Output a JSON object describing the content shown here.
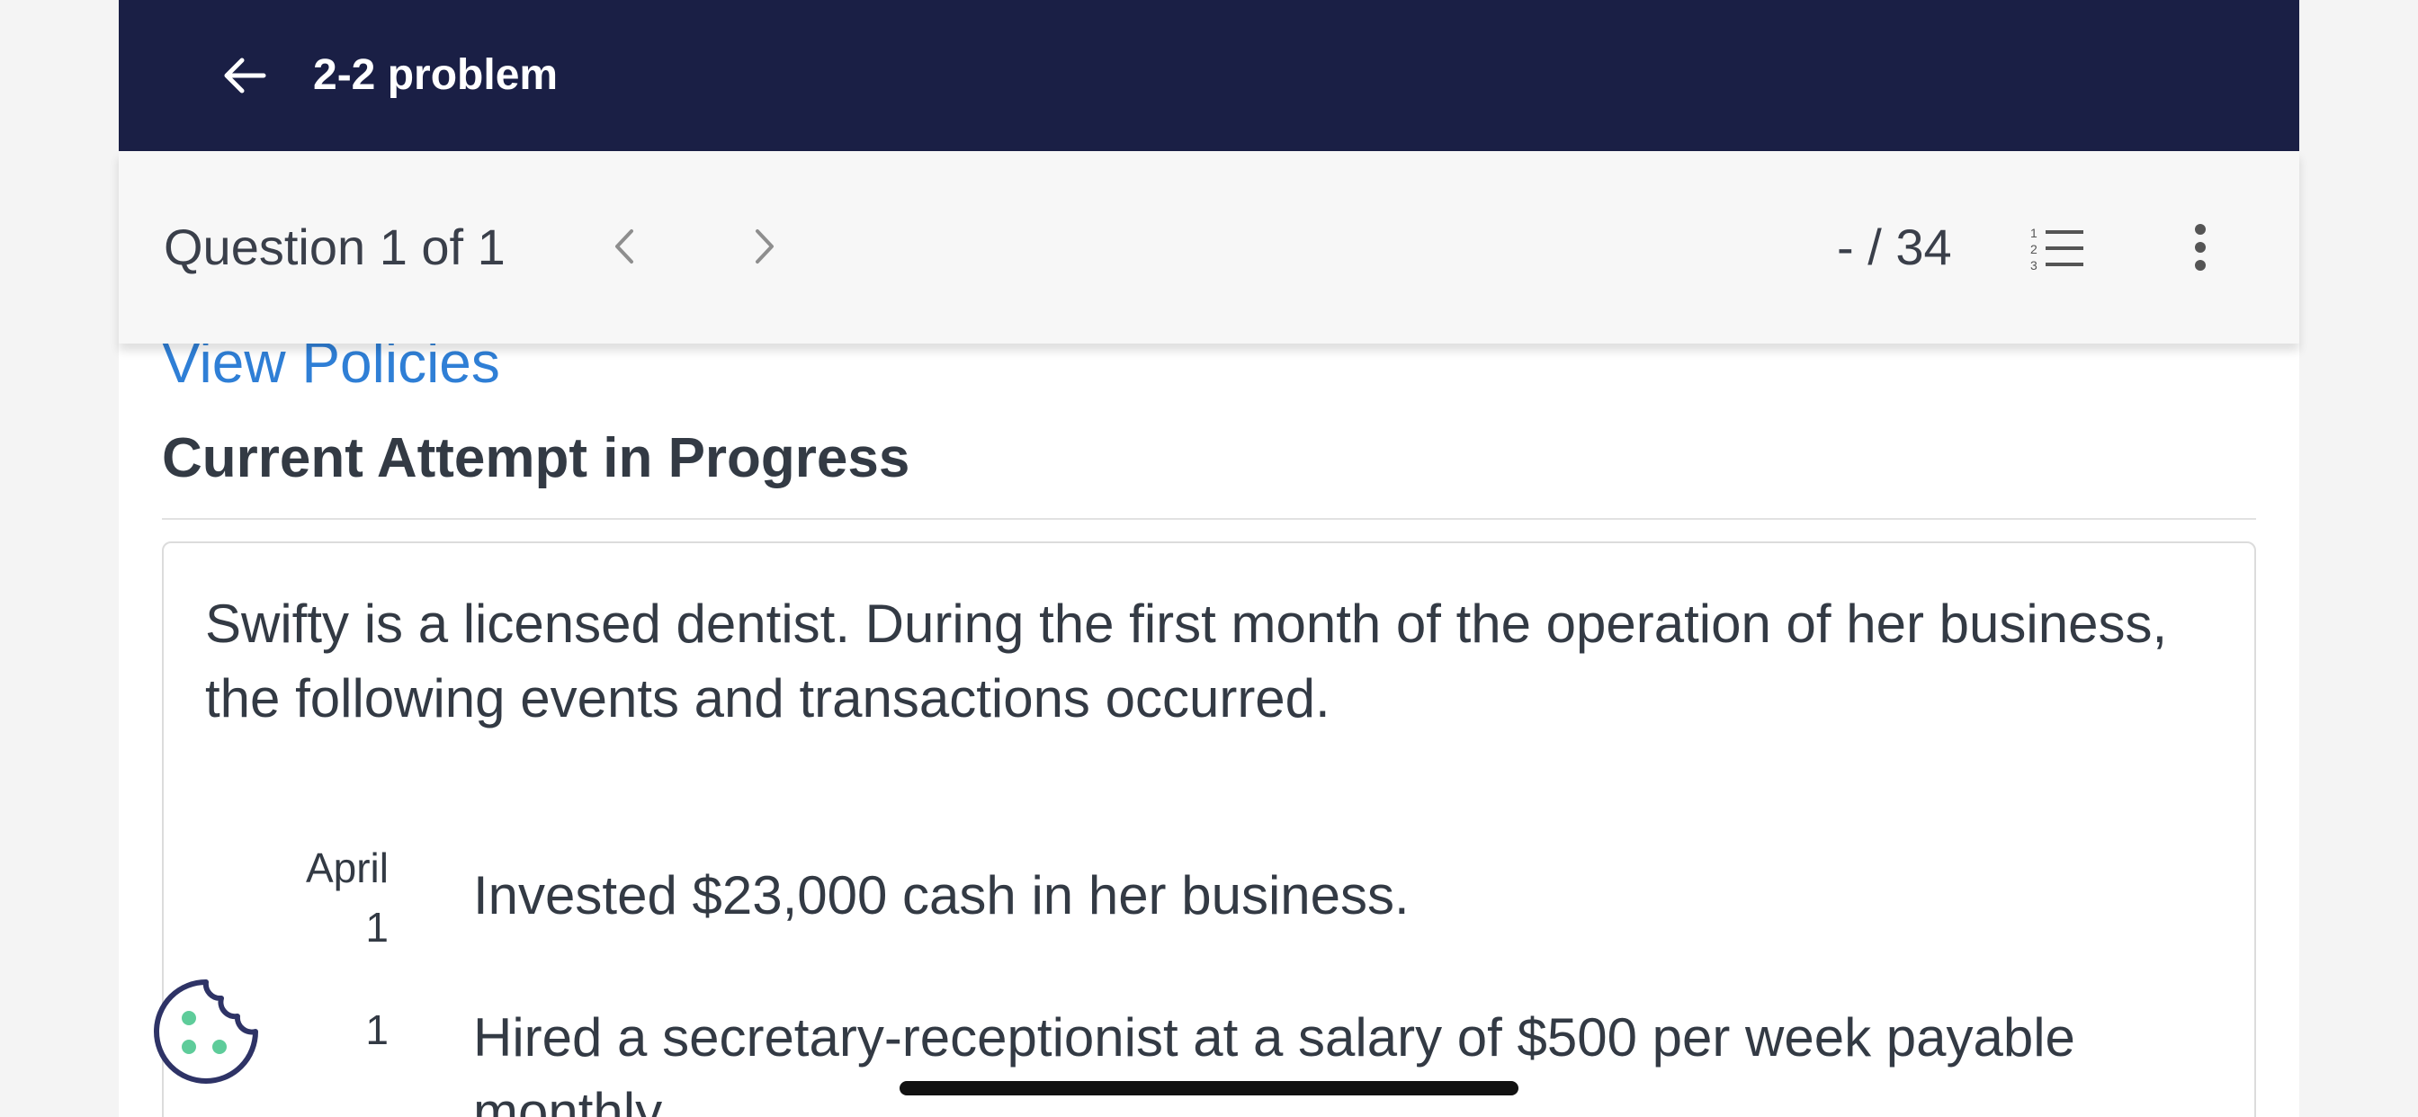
{
  "header": {
    "back_icon": "arrow-left-icon",
    "title": "2-2 problem",
    "bg_color": "#1a1f45"
  },
  "question_bar": {
    "label": "Question 1 of 1",
    "prev_icon": "chevron-left-icon",
    "next_icon": "chevron-right-icon",
    "score": "- / 34",
    "list_icon": "numbered-list-icon",
    "more_icon": "more-vertical-icon"
  },
  "main": {
    "policies_link": "View Policies",
    "attempt_heading": "Current Attempt in Progress",
    "problem": {
      "intro": "Swifty is a licensed dentist. During the first month of the operation of her business, the following events and transactions occurred.",
      "transactions": [
        {
          "month": "April",
          "day": "1",
          "text": "Invested $23,000 cash in her business."
        },
        {
          "month": "",
          "day": "1",
          "text": "Hired a secretary-receptionist at a salary of $500 per week payable monthly."
        }
      ]
    }
  },
  "colors": {
    "link": "#2f7fd6",
    "text": "#333a44",
    "cookie": "#2e3366",
    "cookie_dots": "#5ecc9a"
  },
  "widgets": {
    "cookie_icon": "cookie-icon",
    "home_indicator": "home-indicator"
  }
}
